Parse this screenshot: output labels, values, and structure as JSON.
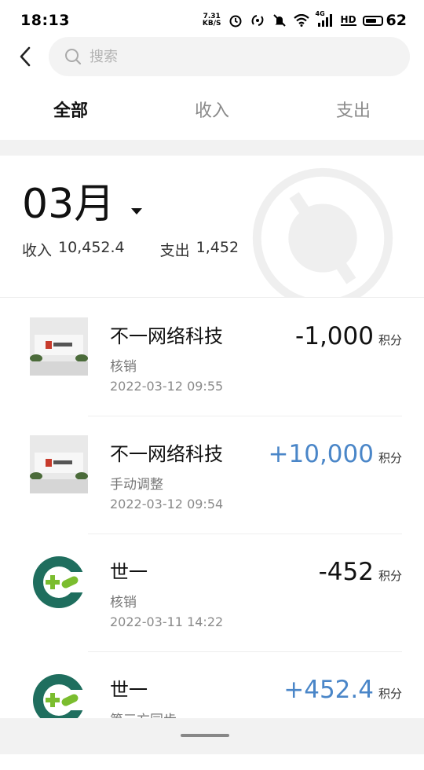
{
  "status_bar": {
    "time": "18:13",
    "net_speed_value": "7.31",
    "net_speed_unit": "KB/S",
    "network_type": "4G",
    "hd_label": "HD",
    "battery": "62",
    "icons": [
      "alarm-icon",
      "nfc-icon",
      "mute-icon",
      "wifi-icon",
      "signal-icon",
      "hd-icon",
      "battery-icon"
    ]
  },
  "search": {
    "placeholder": "搜索"
  },
  "tabs": [
    {
      "label": "全部",
      "active": true
    },
    {
      "label": "收入",
      "active": false
    },
    {
      "label": "支出",
      "active": false
    }
  ],
  "month": {
    "title": "03月",
    "income_label": "收入",
    "income_value": "10,452.4",
    "expense_label": "支出",
    "expense_value": "1,452"
  },
  "transactions": [
    {
      "merchant": "不一网络科技",
      "type": "核销",
      "time": "2022-03-12 09:55",
      "amount": "-1,000",
      "unit": "积分",
      "positive": false,
      "logo": "photo"
    },
    {
      "merchant": "不一网络科技",
      "type": "手动调整",
      "time": "2022-03-12 09:54",
      "amount": "+10,000",
      "unit": "积分",
      "positive": true,
      "logo": "photo"
    },
    {
      "merchant": "世一",
      "type": "核销",
      "time": "2022-03-11 14:22",
      "amount": "-452",
      "unit": "积分",
      "positive": false,
      "logo": "pharmacy"
    },
    {
      "merchant": "世一",
      "type": "第三方同步",
      "time": "",
      "amount": "+452.4",
      "unit": "积分",
      "positive": true,
      "logo": "pharmacy"
    }
  ],
  "colors": {
    "positive_amount": "#4a86c8",
    "negative_amount": "#111111",
    "logo_green": "#1f6e5e",
    "logo_lime": "#7bbd2f"
  }
}
